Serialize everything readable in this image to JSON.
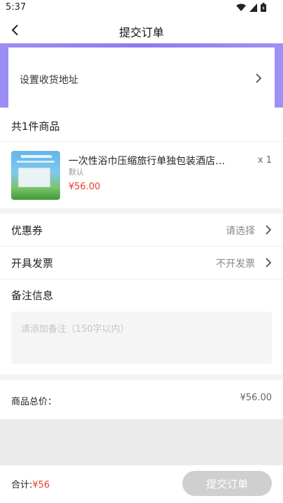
{
  "status_bar": {
    "time": "5:37"
  },
  "nav": {
    "title": "提交订单"
  },
  "address": {
    "placeholder_label": "设置收货地址"
  },
  "goods": {
    "count_label": "共1件商品",
    "items": [
      {
        "name": "一次性浴巾压缩旅行单独包装酒店…",
        "spec": "默认",
        "price": "¥56.00",
        "qty": "x 1"
      }
    ]
  },
  "options": {
    "coupon": {
      "label": "优惠券",
      "value": "请选择"
    },
    "invoice": {
      "label": "开具发票",
      "value": "不开发票"
    },
    "remark": {
      "label": "备注信息",
      "placeholder": "请添加备注（150字以内）"
    }
  },
  "summary": {
    "total_label": "商品总价：",
    "total_value": "¥56.00"
  },
  "bottom": {
    "sum_label": "合计:",
    "sum_amount": "¥56",
    "submit_label": "提交订单"
  },
  "colors": {
    "accent_price": "#e83b2c",
    "header_gradient": "#9b8ef5",
    "submit_disabled": "#cfcfcf"
  }
}
